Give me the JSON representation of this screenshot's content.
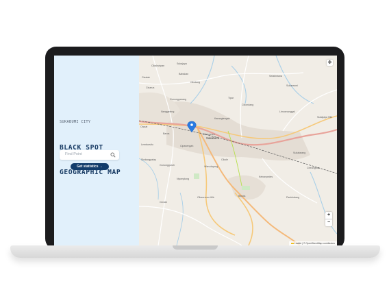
{
  "panel": {
    "eyebrow": "SUKABUMI CITY",
    "title_line1": "BLACK SPOT",
    "title_line2": "GEOGRAPHIC MAP",
    "search_placeholder": "Find Point",
    "stats_button": "Get statistics →"
  },
  "map": {
    "fullscreen_icon": "✥",
    "zoom_in": "+",
    "zoom_out": "−",
    "attribution": "Leaflet | © OpenStreetMap contributors",
    "labels": [
      "Cikahuripan",
      "Sukajaya",
      "Cisalak",
      "Babakan",
      "Cibolang",
      "Selabintana",
      "Cisarua",
      "Sukaresmi",
      "Gunungparang",
      "Tipar",
      "Nanggeleng",
      "Cikondang",
      "Limusnunggal",
      "Karangtengah",
      "Sudajaya Hilir",
      "Cisaat",
      "Baros",
      "Cibeureum",
      "Lembursitu",
      "Cipanengah",
      "Sukalarang",
      "Cireunghas",
      "Sindangpalay",
      "Gunungguruh",
      "Kebonpedes",
      "Benda",
      "Warudoyong",
      "Nyomplong",
      "Cibeureum Hilir",
      "Cikole",
      "Cimahi",
      "Pasirhalang",
      "Sukabumi"
    ],
    "city_label": "Sukabumi"
  },
  "colors": {
    "accent": "#123c6b",
    "title": "#173a63",
    "panel_bg": "#e1f0fb",
    "map_bg": "#f1ede6",
    "marker": "#2a7ae2"
  }
}
